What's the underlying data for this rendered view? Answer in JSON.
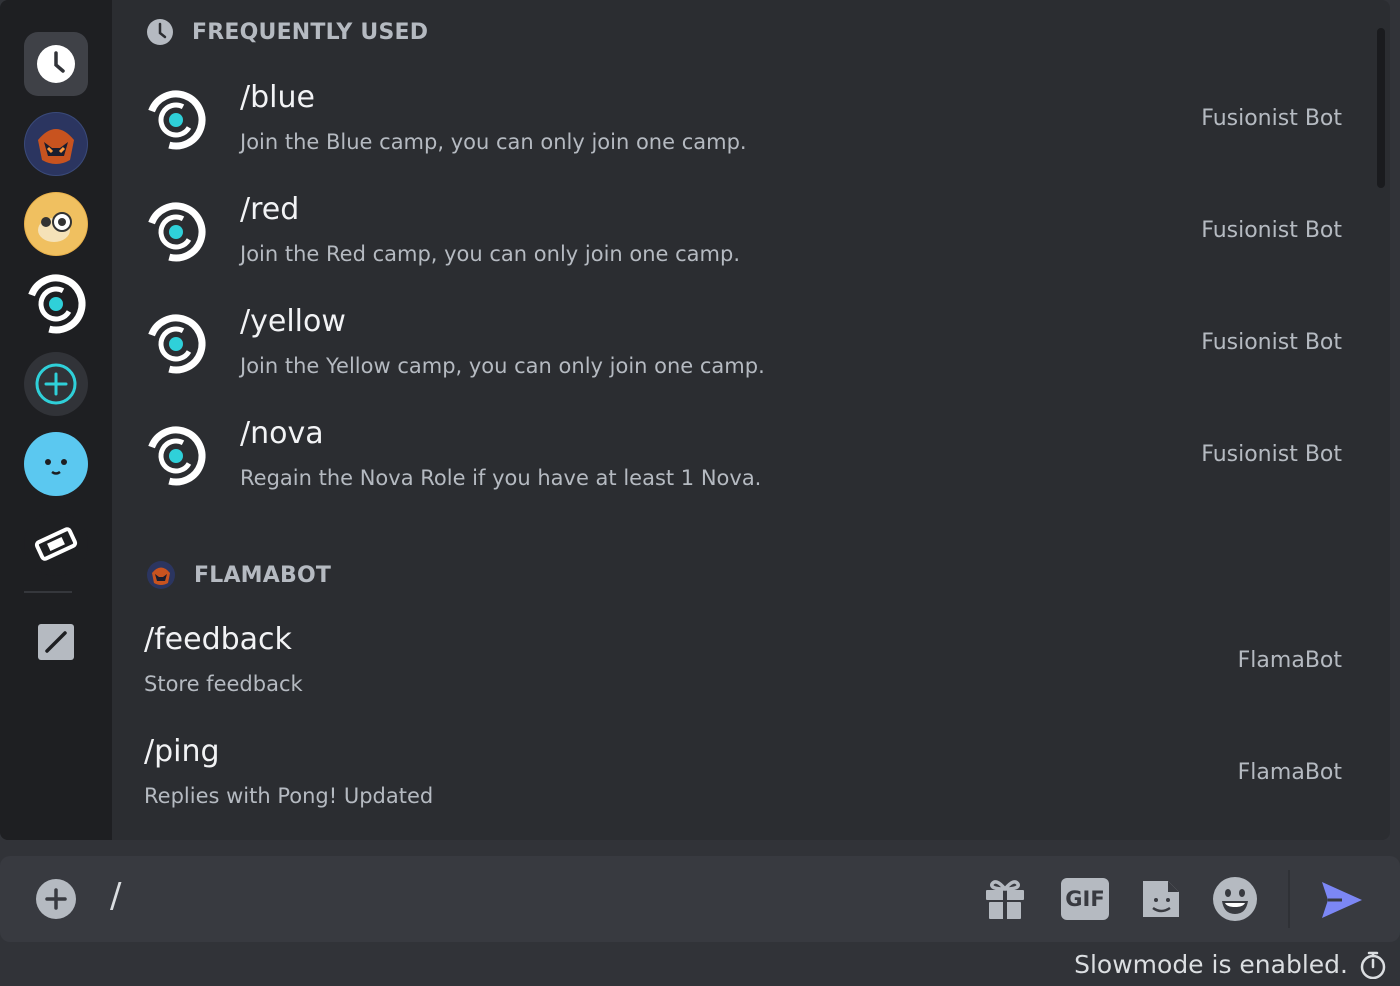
{
  "sections": {
    "frequent": {
      "title": "FREQUENTLY USED"
    },
    "flamabot": {
      "title": "FLAMABOT"
    }
  },
  "frequent_commands": [
    {
      "name": "/blue",
      "description": "Join the Blue camp, you can only join one camp.",
      "source": "Fusionist Bot"
    },
    {
      "name": "/red",
      "description": "Join the Red camp, you can only join one camp.",
      "source": "Fusionist Bot"
    },
    {
      "name": "/yellow",
      "description": "Join the Yellow camp, you can only join one camp.",
      "source": "Fusionist Bot"
    },
    {
      "name": "/nova",
      "description": "Regain the Nova Role if you have at least 1 Nova.",
      "source": "Fusionist Bot"
    }
  ],
  "flamabot_commands": [
    {
      "name": "/feedback",
      "description": "Store feedback",
      "source": "FlamaBot"
    },
    {
      "name": "/ping",
      "description": "Replies with Pong! Updated",
      "source": "FlamaBot"
    }
  ],
  "rail": {
    "items": [
      "clock-icon",
      "flamabot-avatar",
      "monkey-avatar",
      "fusionist-avatar",
      "add-app-icon",
      "smiley-avatar",
      "ticket-icon",
      "edit-icon"
    ]
  },
  "composer": {
    "value": "/",
    "icons": [
      "add-icon",
      "gift-icon",
      "gif-icon",
      "sticker-icon",
      "emoji-icon",
      "send-icon"
    ],
    "gif_label": "GIF"
  },
  "footer": {
    "slowmode_text": "Slowmode is enabled."
  },
  "colors": {
    "accent": "#5865f2",
    "teal": "#2fd0d9",
    "background": "#2b2d31",
    "rail": "#1e1f22",
    "composer": "#383a40"
  }
}
